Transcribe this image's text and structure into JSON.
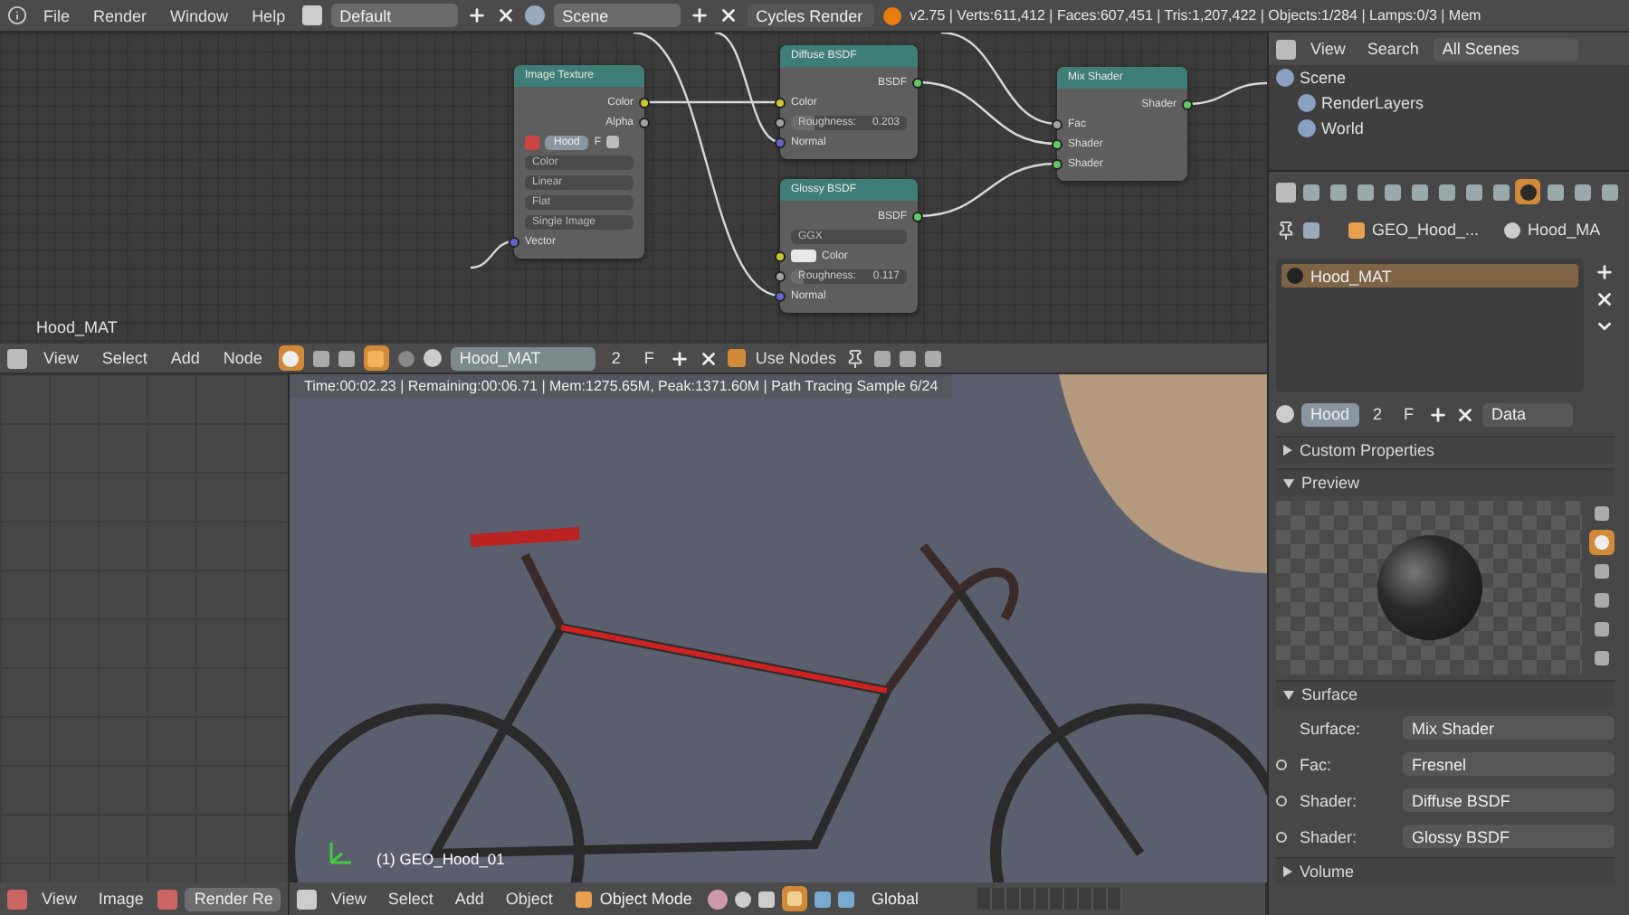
{
  "top_bar": {
    "menus": [
      "File",
      "Render",
      "Window",
      "Help"
    ],
    "layout": "Default",
    "scene": "Scene",
    "engine": "Cycles Render",
    "stats": "v2.75 | Verts:611,412 | Faces:607,451 | Tris:1,207,422 | Objects:1/284 | Lamps:0/3 | Mem"
  },
  "node_editor": {
    "frame_label": "Hood_MAT",
    "nodes": [
      {
        "title": "Image Texture",
        "rows": [
          {
            "kind": "output",
            "label": "Color",
            "color": "#c7c729"
          },
          {
            "kind": "output",
            "label": "Alpha",
            "color": "#a1a1a1"
          },
          {
            "kind": "image",
            "name": "Hood",
            "fake": "F"
          },
          {
            "kind": "dropdown",
            "label": "Color"
          },
          {
            "kind": "dropdown",
            "label": "Linear"
          },
          {
            "kind": "dropdown",
            "label": "Flat"
          },
          {
            "kind": "dropdown",
            "label": "Single Image"
          },
          {
            "kind": "input",
            "label": "Vector",
            "color": "#6363c7"
          }
        ]
      },
      {
        "title": "Diffuse BSDF",
        "rows": [
          {
            "kind": "output",
            "label": "BSDF",
            "color": "#63c763"
          },
          {
            "kind": "input",
            "label": "Color",
            "color": "#c7c729"
          },
          {
            "kind": "value",
            "label": "Roughness:",
            "value": "0.203",
            "level": 0.203,
            "color": "#a1a1a1"
          },
          {
            "kind": "input",
            "label": "Normal",
            "color": "#6363c7"
          }
        ]
      },
      {
        "title": "Glossy BSDF",
        "rows": [
          {
            "kind": "output",
            "label": "BSDF",
            "color": "#63c763"
          },
          {
            "kind": "dropdown",
            "label": "GGX"
          },
          {
            "kind": "color",
            "label": "Color",
            "color": "#c7c729"
          },
          {
            "kind": "value",
            "label": "Roughness:",
            "value": "0.117",
            "level": 0.117,
            "color": "#a1a1a1"
          },
          {
            "kind": "input",
            "label": "Normal",
            "color": "#6363c7"
          }
        ]
      },
      {
        "title": "Mix Shader",
        "rows": [
          {
            "kind": "output",
            "label": "Shader",
            "color": "#63c763"
          },
          {
            "kind": "input",
            "label": "Fac",
            "color": "#a1a1a1"
          },
          {
            "kind": "input",
            "label": "Shader",
            "color": "#63c763"
          },
          {
            "kind": "input",
            "label": "Shader",
            "color": "#63c763"
          }
        ]
      }
    ]
  },
  "node_header": {
    "menus": [
      "View",
      "Select",
      "Add",
      "Node"
    ],
    "material": "Hood_MAT",
    "users": "2",
    "fake": "F",
    "use_nodes": {
      "label": "Use Nodes",
      "checked": true
    }
  },
  "viewport": {
    "render_info": "Time:00:02.23 | Remaining:00:06.71 | Mem:1275.65M, Peak:1371.60M | Path Tracing Sample 6/24",
    "object_label": "(1) GEO_Hood_01"
  },
  "image_header": {
    "menus": [
      "View",
      "Image"
    ],
    "image": "Render Re"
  },
  "view3d_header": {
    "menus": [
      "View",
      "Select",
      "Add",
      "Object"
    ],
    "mode": "Object Mode",
    "orientation": "Global"
  },
  "outliner": {
    "menus": [
      "View",
      "Search"
    ],
    "filter": "All Scenes",
    "tree": [
      {
        "label": "Scene",
        "children": [
          {
            "label": "RenderLayers"
          },
          {
            "label": "World"
          }
        ]
      }
    ]
  },
  "properties": {
    "tabs": [
      {
        "selected": false
      },
      {
        "selected": false
      },
      {
        "selected": false
      },
      {
        "selected": false
      },
      {
        "selected": false
      },
      {
        "selected": false
      },
      {
        "selected": false
      },
      {
        "selected": false
      },
      {
        "selected": true
      },
      {
        "selected": false
      },
      {
        "selected": false
      },
      {
        "selected": false
      }
    ],
    "breadcrumb": [
      "GEO_Hood_...",
      "Hood_MA"
    ],
    "materials": [
      {
        "name": "Hood_MAT",
        "selected": true
      }
    ],
    "datablock": {
      "name": "Hood",
      "users": "2",
      "fake": "F",
      "link": "Data"
    },
    "panels": [
      {
        "title": "Custom Properties",
        "expanded": false,
        "kind": "empty"
      },
      {
        "title": "Preview",
        "expanded": true,
        "kind": "preview",
        "types": [
          {
            "selected": false
          },
          {
            "selected": true
          },
          {
            "selected": false
          },
          {
            "selected": false
          },
          {
            "selected": false
          },
          {
            "selected": false
          }
        ]
      },
      {
        "title": "Surface",
        "expanded": true,
        "kind": "surface",
        "rows": [
          {
            "label": "Surface:",
            "value": "Mix Shader",
            "socket": false
          },
          {
            "label": "Fac:",
            "value": "Fresnel",
            "socket": true
          },
          {
            "label": "Shader:",
            "value": "Diffuse BSDF",
            "socket": true
          },
          {
            "label": "Shader:",
            "value": "Glossy BSDF",
            "socket": true
          }
        ]
      },
      {
        "title": "Volume",
        "expanded": false,
        "kind": "empty"
      }
    ]
  }
}
